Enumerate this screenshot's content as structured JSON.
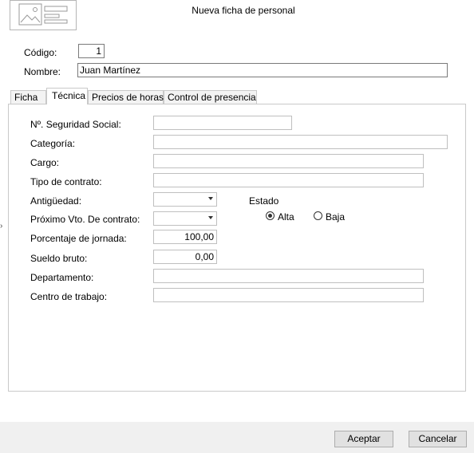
{
  "window": {
    "title": "Nueva ficha de personal"
  },
  "header": {
    "codigo_label": "Código:",
    "codigo_value": "1",
    "nombre_label": "Nombre:",
    "nombre_value": "Juan Martínez"
  },
  "tabs": [
    {
      "label": "Ficha",
      "active": false
    },
    {
      "label": "Técnica",
      "active": true
    },
    {
      "label": "Precios de horas",
      "active": false
    },
    {
      "label": "Control de presencia",
      "active": false
    }
  ],
  "tecnica": {
    "seguridad_social": {
      "label": "Nº. Seguridad Social:",
      "value": ""
    },
    "categoria": {
      "label": "Categoría:",
      "value": ""
    },
    "cargo": {
      "label": "Cargo:",
      "value": ""
    },
    "tipo_contrato": {
      "label": "Tipo de contrato:",
      "value": ""
    },
    "antiguedad": {
      "label": "Antigüedad:",
      "value": ""
    },
    "proximo_vto": {
      "label": "Próximo Vto. De contrato:",
      "value": ""
    },
    "porcentaje_jornada": {
      "label": "Porcentaje de jornada:",
      "value": "100,00"
    },
    "sueldo_bruto": {
      "label": "Sueldo bruto:",
      "value": "0,00"
    },
    "departamento": {
      "label": "Departamento:",
      "value": ""
    },
    "centro_trabajo": {
      "label": "Centro de trabajo:",
      "value": ""
    },
    "estado": {
      "label": "Estado",
      "options": [
        {
          "label": "Alta",
          "selected": true
        },
        {
          "label": "Baja",
          "selected": false
        }
      ]
    }
  },
  "footer": {
    "accept_label": "Aceptar",
    "cancel_label": "Cancelar"
  },
  "icons": {
    "photo": "image-placeholder-icon",
    "dropdown": "chevron-down-icon",
    "side": "chevron-right-icon"
  }
}
